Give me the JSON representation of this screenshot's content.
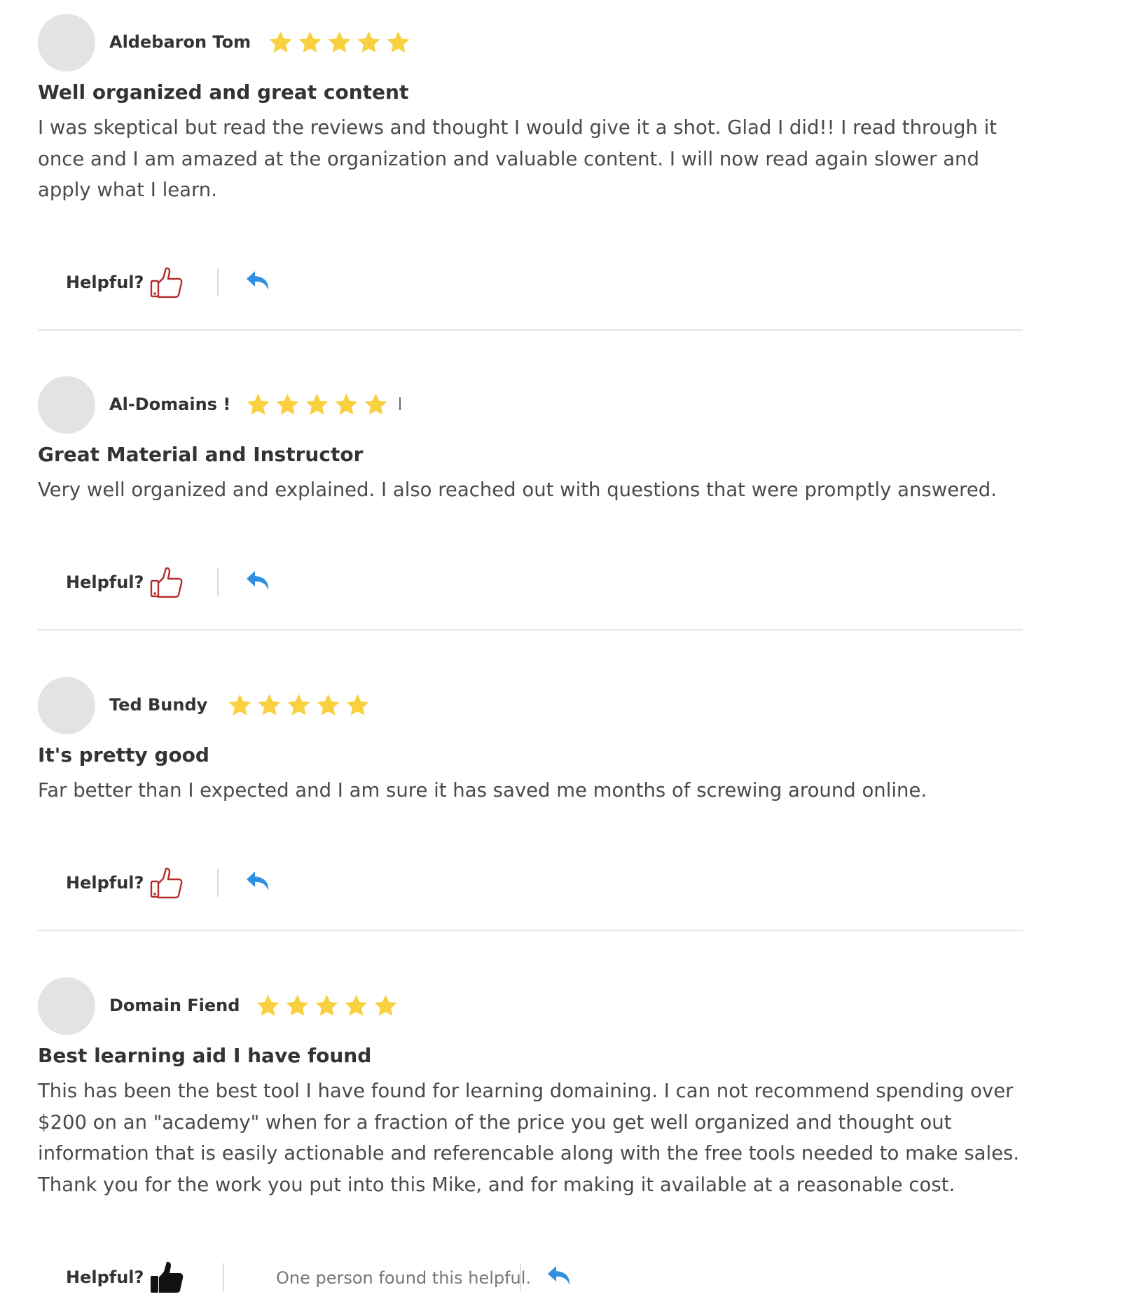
{
  "reviews": [
    {
      "author": "Aldebaron Tom",
      "rating": 5,
      "title": "Well organized and great content",
      "body": "I was skeptical but read the reviews and thought I would give it a shot. Glad I did!! I read through it once and I am amazed at the organization and valuable content. I will now read again slower and apply what I learn.",
      "helpful_label": "Helpful?",
      "helpful_text": "",
      "voted": false
    },
    {
      "author": "Al-Domains !",
      "rating": 5,
      "title": "Great Material and Instructor",
      "body": "Very well organized and explained. I also reached out with questions that were promptly answered.",
      "helpful_label": "Helpful?",
      "helpful_text": "",
      "voted": false
    },
    {
      "author": "Ted Bundy",
      "rating": 5,
      "title": "It's pretty good",
      "body": "Far better than I expected and I am sure it has saved me months of screwing around online.",
      "helpful_label": "Helpful?",
      "helpful_text": "",
      "voted": false
    },
    {
      "author": "Domain Fiend",
      "rating": 5,
      "title": "Best learning aid I have found",
      "body": "This has been the best tool I have found for learning domaining. I can not recommend spending over $200 on an \"academy\" when for a fraction of the price you get well organized and thought out information that is easily actionable and referencable along with the free tools needed to make sales. Thank you for the work you put into this Mike, and for making it available at a reasonable cost.",
      "helpful_label": "Helpful?",
      "helpful_text": "One person found this helpful.",
      "voted": true
    }
  ],
  "colors": {
    "star": "#F9D03F",
    "thumb_outline": "#B32D2D",
    "thumb_voted": "#111111",
    "reply": "#2F8FE0",
    "avatar": "#E3E3E3",
    "separator": "#E6E6E6"
  },
  "icons": {
    "star": "star-icon",
    "thumb": "thumbs-up-icon",
    "reply": "reply-icon"
  }
}
